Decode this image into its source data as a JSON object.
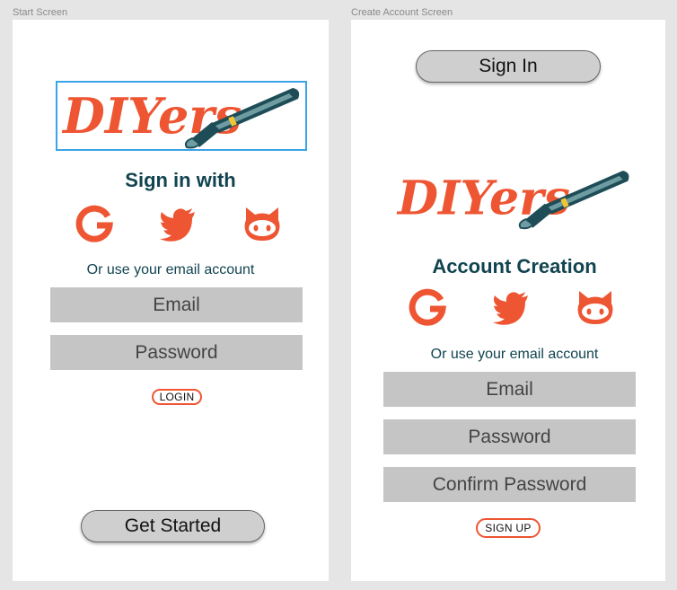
{
  "colors": {
    "brand_orange": "#ee5532",
    "heading_teal": "#114450",
    "field_gray": "#c5c5c5",
    "canvas_gray": "#e5e5e5",
    "selection_blue": "#3ba3e8"
  },
  "start_screen": {
    "label": "Start Screen",
    "logo_text": "DIYers",
    "heading": "Sign in with",
    "social_icons": [
      "google-icon",
      "twitter-icon",
      "github-icon"
    ],
    "alt_text": "Or use your email account",
    "email_placeholder": "Email",
    "password_placeholder": "Password",
    "login_label": "LOGIN",
    "get_started_label": "Get Started"
  },
  "create_account_screen": {
    "label": "Create Account Screen",
    "sign_in_label": "Sign In",
    "logo_text": "DIYers",
    "heading": "Account Creation",
    "social_icons": [
      "google-icon",
      "twitter-icon",
      "github-icon"
    ],
    "alt_text": "Or use your email account",
    "email_placeholder": "Email",
    "password_placeholder": "Password",
    "confirm_password_placeholder": "Confirm Password",
    "signup_label": "SIGN UP"
  }
}
